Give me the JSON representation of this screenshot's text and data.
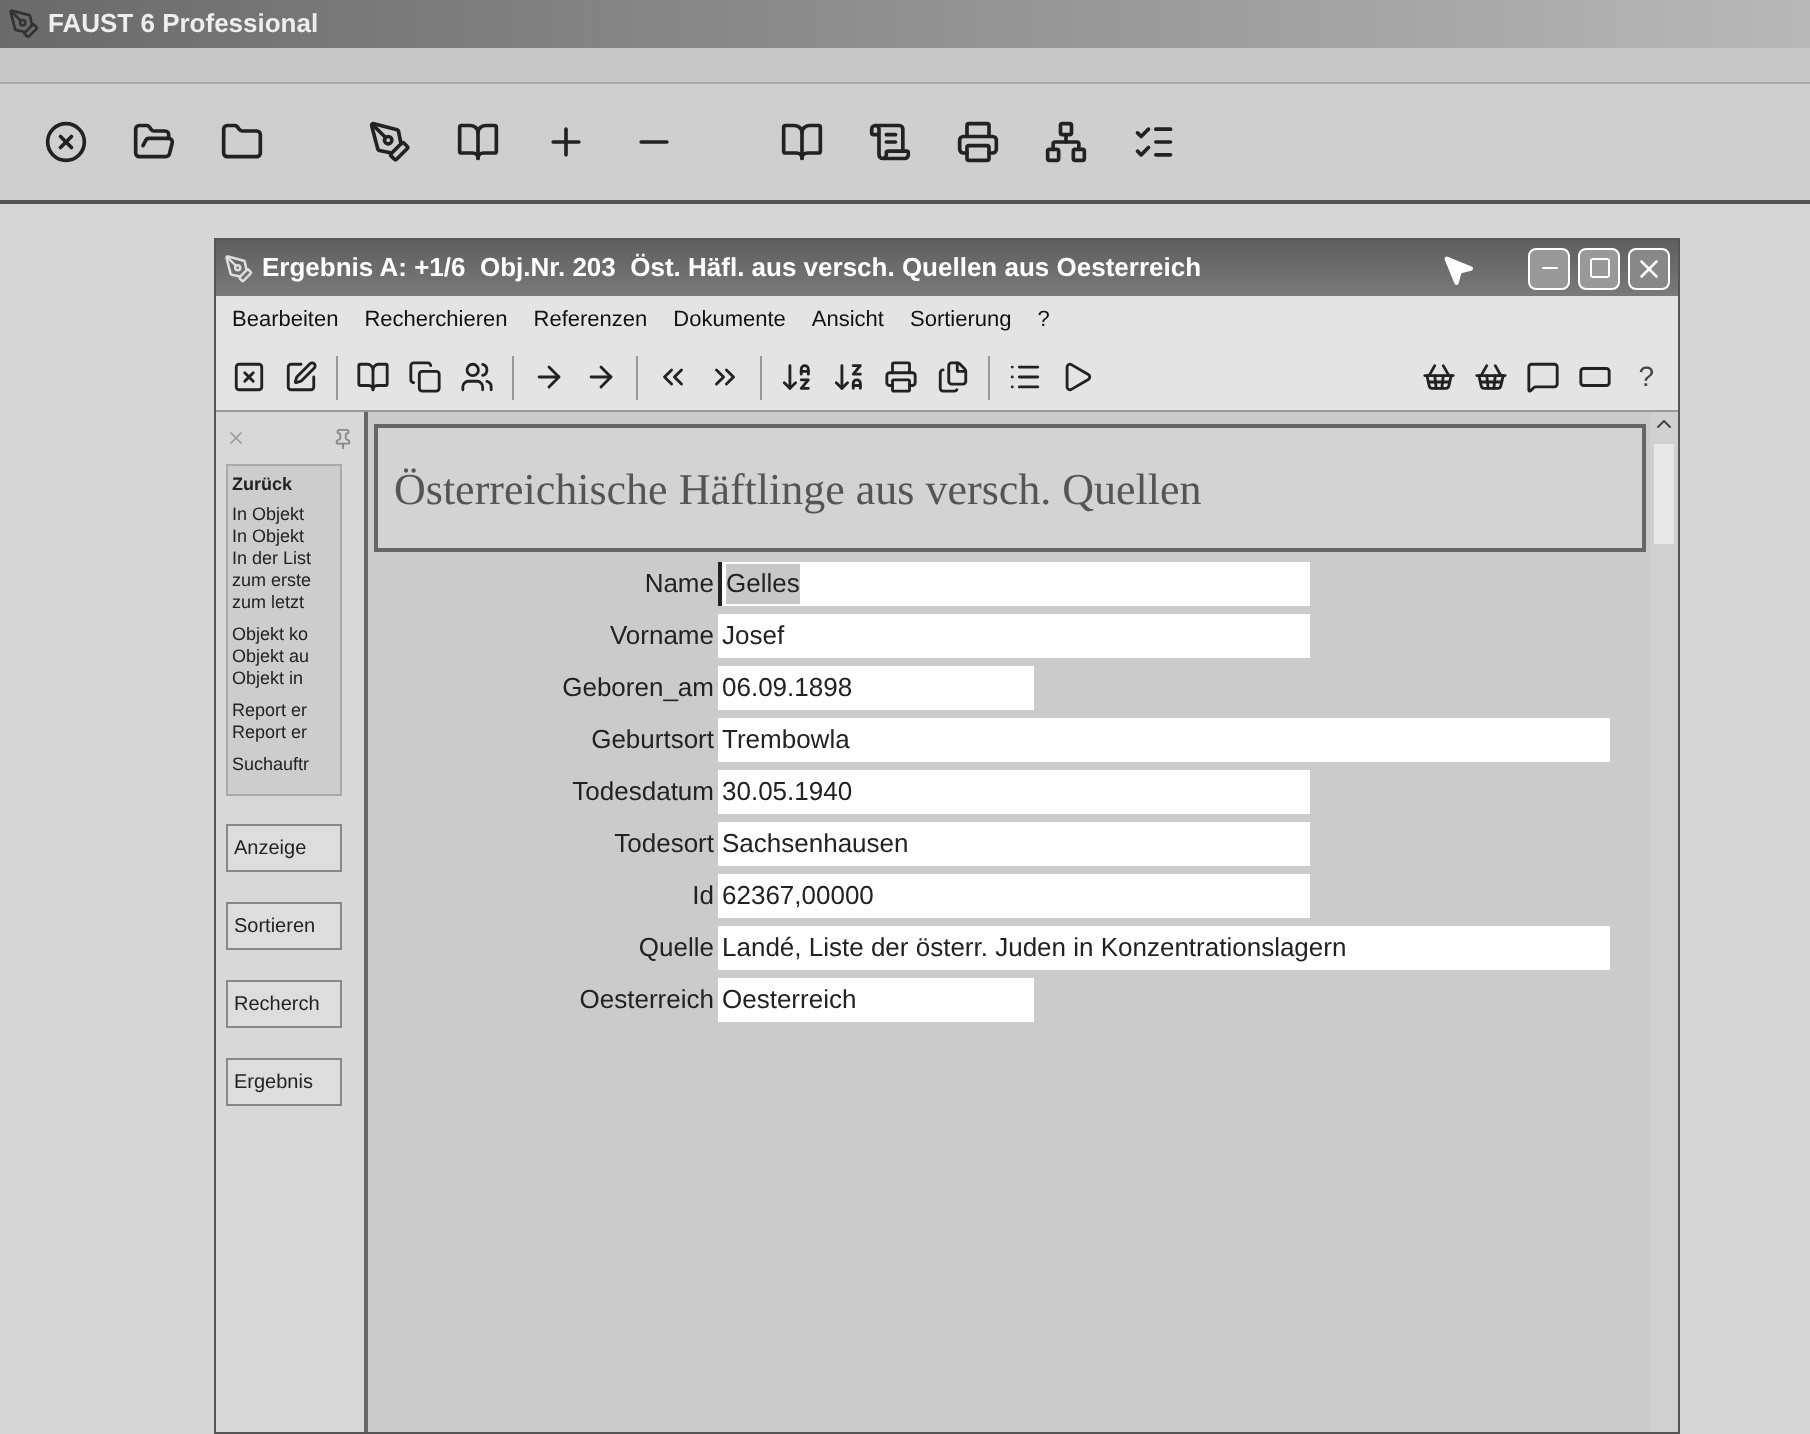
{
  "app": {
    "title": "FAUST 6 Professional"
  },
  "window": {
    "title": "Ergebnis A: +1/6  Obj.Nr. 203  Öst. Häfl. aus versch. Quellen aus Oesterreich",
    "menu": [
      "Bearbeiten",
      "Recherchieren",
      "Referenzen",
      "Dokumente",
      "Ansicht",
      "Sortierung",
      "?"
    ],
    "toolbar_help": "?"
  },
  "side_pane": {
    "header": "Zurück",
    "groups": [
      [
        "In Objekt",
        "In Objekt",
        "In der List",
        "zum erste",
        "zum letzt"
      ],
      [
        "Objekt ko",
        "Objekt au",
        "Objekt in"
      ],
      [
        "Report er",
        "Report er"
      ],
      [
        "Suchauftr"
      ]
    ],
    "buttons": [
      "Anzeige",
      "Sortieren",
      "Recherch",
      "Ergebnis"
    ]
  },
  "form": {
    "heading": "Österreichische Häftlinge aus versch. Quellen",
    "fields": [
      {
        "label": "Name",
        "value": "Gelles",
        "focused": true
      },
      {
        "label": "Vorname",
        "value": "Josef",
        "focused": false
      },
      {
        "label": "Geboren_am",
        "value": "06.09.1898",
        "focused": false
      },
      {
        "label": "Geburtsort",
        "value": "Trembowla",
        "focused": false
      },
      {
        "label": "Todesdatum",
        "value": "30.05.1940",
        "focused": false
      },
      {
        "label": "Todesort",
        "value": "Sachsenhausen",
        "focused": false
      },
      {
        "label": "Id",
        "value": "62367,00000",
        "focused": false
      },
      {
        "label": "Quelle",
        "value": "Landé, Liste der österr. Juden in Konzentrationslagern",
        "focused": false
      },
      {
        "label": "Oesterreich",
        "value": "Oesterreich",
        "focused": false
      }
    ]
  }
}
